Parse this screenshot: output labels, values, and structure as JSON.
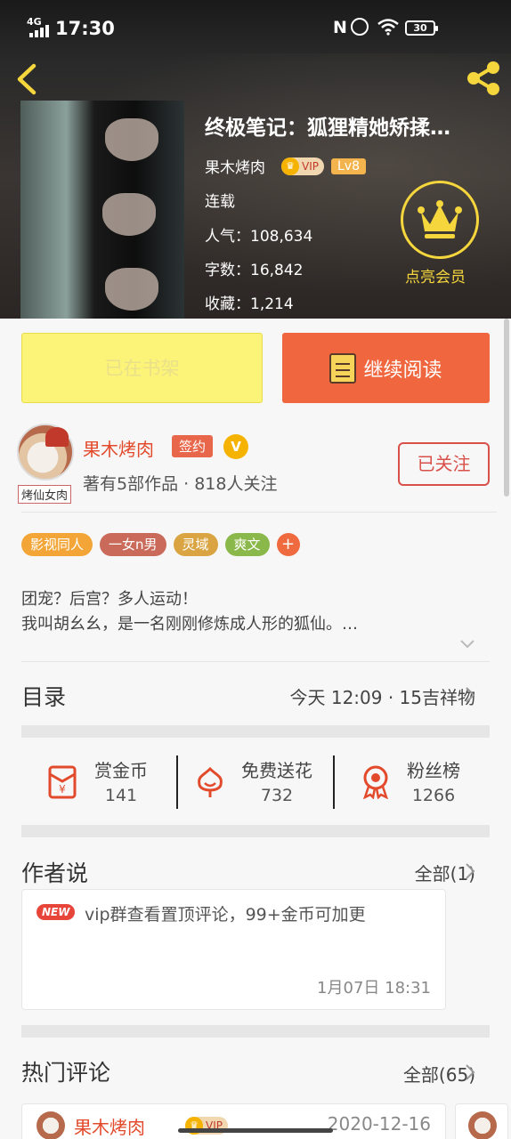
{
  "status_bar": {
    "network": "4G",
    "time": "17:30",
    "battery": "30"
  },
  "book": {
    "title": "终极笔记：狐狸精她矫揉…",
    "author": "果木烤肉",
    "vip": "VIP",
    "level": "Lv8",
    "status": "连载",
    "popularity": "人气：108,634",
    "word_count": "字数：16,842",
    "favorites": "收藏：1,214",
    "member_label": "点亮会员"
  },
  "actions": {
    "shelf_label": "已在书架",
    "read_label": "继续阅读"
  },
  "author_card": {
    "avatar_tag": "烤仙女肉",
    "name": "果木烤肉",
    "signed_label": "签约",
    "v_badge": "V",
    "stats": "著有5部作品 · 818人关注",
    "follow_label": "已关注"
  },
  "tags": [
    {
      "label": "影视同人",
      "color": "#f3a637"
    },
    {
      "label": "一女n男",
      "color": "#c96a5a"
    },
    {
      "label": "灵域",
      "color": "#d9a441"
    },
    {
      "label": "爽文",
      "color": "#8bb84a"
    },
    {
      "label": "+",
      "color": "#ef6a3f"
    }
  ],
  "synopsis": {
    "line1": "团宠？后宫？多人运动！",
    "line2": "我叫胡幺幺，是一名刚刚修炼成人形的狐仙。…"
  },
  "catalog": {
    "title": "目录",
    "update": "今天 12:09 · 15吉祥物"
  },
  "stats": [
    {
      "label": "赏金币",
      "value": "141",
      "icon": "red-envelope-icon"
    },
    {
      "label": "免费送花",
      "value": "732",
      "icon": "flower-icon"
    },
    {
      "label": "粉丝榜",
      "value": "1266",
      "icon": "medal-icon"
    }
  ],
  "author_says": {
    "title": "作者说",
    "all": "全部(1)",
    "new_badge": "NEW",
    "text": "vip群查看置顶评论，99+金币可加更",
    "time": "1月07日  18:31"
  },
  "hot_comments": {
    "title": "热门评论",
    "all": "全部(65)",
    "first": {
      "name": "果木烤肉",
      "vip": "VIP",
      "date": "2020-12-16"
    }
  },
  "colors": {
    "accent": "#f0673f",
    "gold": "#f5d63d",
    "author_red": "#e24a2b"
  }
}
